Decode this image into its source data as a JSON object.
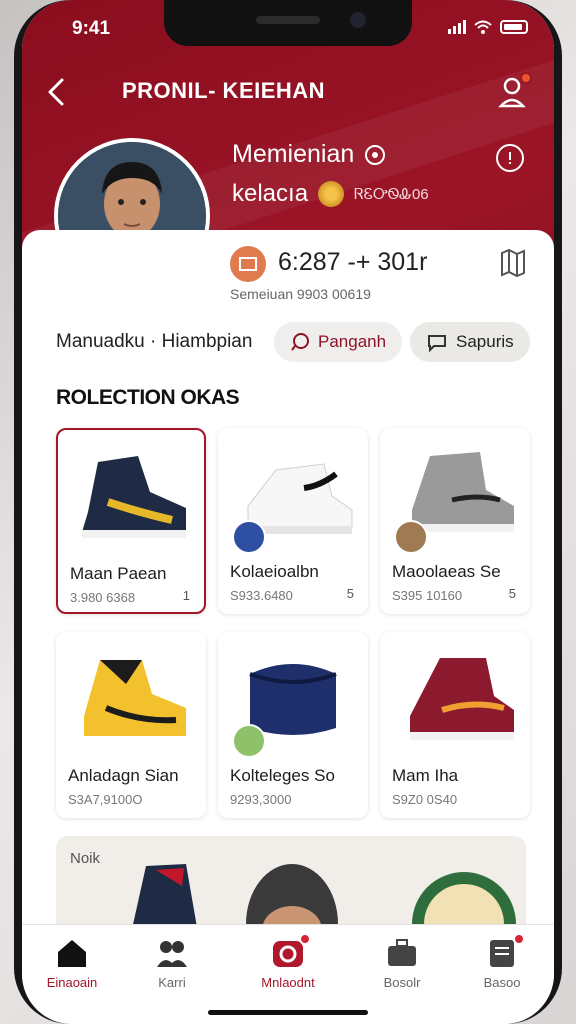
{
  "status": {
    "time": "9:41"
  },
  "header": {
    "title": "PRONIL- KEIEHAN"
  },
  "profile": {
    "name": "Memienian",
    "sub_label": "kelacıa",
    "sub_small": "ᏒᏋᎤᏫᎲ06",
    "stat_value": "6:287 -+ 301r",
    "stat_sub": "Semeiuan 9903 00619"
  },
  "actions": {
    "section_label": "Manuadku · Hiambpian",
    "pill_a": "Panganh",
    "pill_b": "Sapuris"
  },
  "collection": {
    "title": "ROLECTION OKAS",
    "items": [
      {
        "name": "Maan Paean",
        "price": "3.980 6368",
        "num": "1",
        "selected": true
      },
      {
        "name": "Kolaeioalbn",
        "price": "S933.6480",
        "num": "5",
        "selected": false
      },
      {
        "name": "Maoolaeas Se",
        "price": "S395 10160",
        "num": "5",
        "selected": false
      },
      {
        "name": "Anladagn Sian",
        "price": "S3A7,9100O",
        "num": "",
        "selected": false
      },
      {
        "name": "Kolteleges So",
        "price": "9293,3000",
        "num": "",
        "selected": false
      },
      {
        "name": "Mam Iha",
        "price": "S9Z0 0S40",
        "num": "",
        "selected": false
      }
    ]
  },
  "bottom_card": {
    "label": "Noik"
  },
  "tabs": [
    {
      "label": "Einaoain",
      "icon": "home-icon",
      "active": true
    },
    {
      "label": "Karri",
      "icon": "people-icon",
      "active": false
    },
    {
      "label": "Mnlaodnt",
      "icon": "camera-icon",
      "active": true
    },
    {
      "label": "Bosolr",
      "icon": "briefcase-icon",
      "active": false
    },
    {
      "label": "Basoo",
      "icon": "document-icon",
      "active": false
    }
  ],
  "colors": {
    "brand": "#9b1527",
    "accent": "#a3162a",
    "gold": "#e3a12d"
  }
}
